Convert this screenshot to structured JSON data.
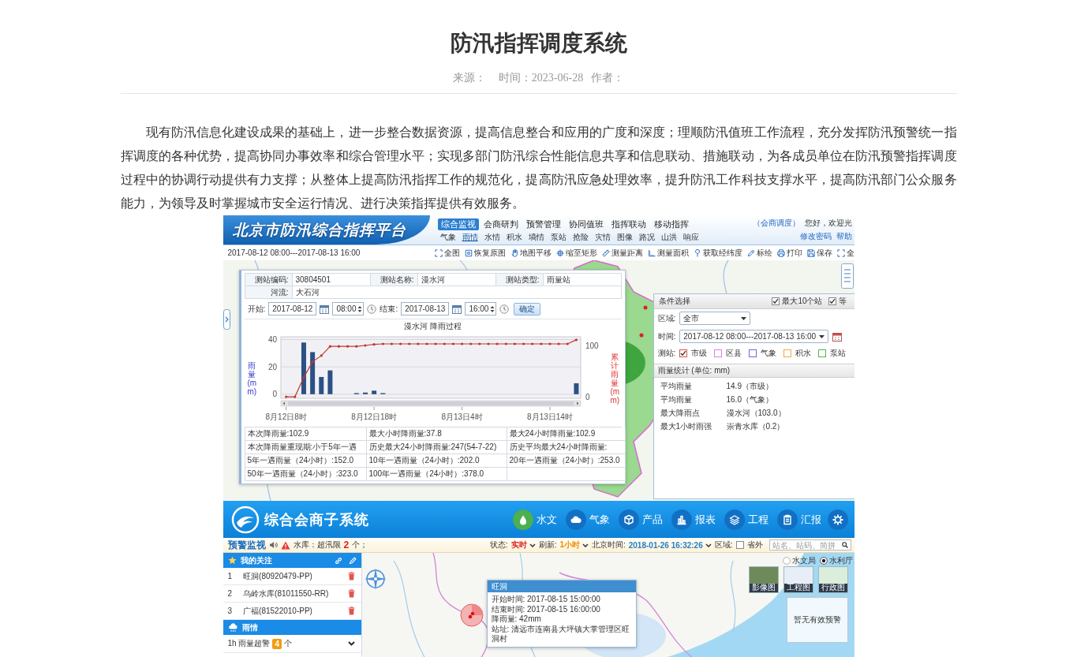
{
  "article": {
    "title": "防汛指挥调度系统",
    "meta": {
      "source_label": "来源：",
      "time_label": "时间：",
      "date": "2023-06-28",
      "author_label": "作者："
    },
    "paragraph": "现有防汛信息化建设成果的基础上，进一步整合数据资源，提高信息整合和应用的广度和深度；理顺防汛值班工作流程，充分发挥防汛预警统一指挥调度的各种优势，提高协同办事效率和综合管理水平；实现多部门防汛综合性能信息共享和信息联动、措施联动，为各成员单位在防汛预警指挥调度过程中的协调行动提供有力支撑；从整体上提高防汛指挥工作的规范化，提高防汛应急处理效率，提升防汛工作科技支撑水平，提高防汛部门公众服务能力，为领导及时掌握城市安全运行情况、进行决策指挥提供有效服务。"
  },
  "platform": {
    "title": "北京市防汛综合指挥平台",
    "main_nav": [
      {
        "label": "综合监视",
        "selected": true
      },
      {
        "label": "会商研判",
        "selected": false
      },
      {
        "label": "预警管理",
        "selected": false
      },
      {
        "label": "协同值班",
        "selected": false
      },
      {
        "label": "指挥联动",
        "selected": false
      },
      {
        "label": "移动指挥",
        "selected": false
      }
    ],
    "sub_nav": [
      {
        "label": "气象",
        "selected": false
      },
      {
        "label": "雨情",
        "selected": true
      },
      {
        "label": "水情",
        "selected": false
      },
      {
        "label": "积水",
        "selected": false
      },
      {
        "label": "墒情",
        "selected": false
      },
      {
        "label": "泵站",
        "selected": false
      },
      {
        "label": "抢险",
        "selected": false
      },
      {
        "label": "灾情",
        "selected": false
      },
      {
        "label": "图像",
        "selected": false
      },
      {
        "label": "路况",
        "selected": false
      },
      {
        "label": "山洪",
        "selected": false
      },
      {
        "label": "响应",
        "selected": false
      }
    ],
    "user": {
      "role": "（会商调度）",
      "greeting": "您好，欢迎光",
      "links": [
        "修改密码",
        "帮助"
      ]
    },
    "time_range": "2017-08-12 08:00---2017-08-13 16:00",
    "tools": [
      "全图",
      "恢复原图",
      "地图平移",
      "缩至矩形",
      "测量距离",
      "测量面积",
      "获取经纬度",
      "标绘",
      "打印",
      "保存",
      "全"
    ],
    "station_panel": {
      "info": [
        {
          "label": "测站编码:",
          "value": "30804501"
        },
        {
          "label": "测站名称:",
          "value": "漫水河"
        },
        {
          "label": "测站类型:",
          "value": "雨量站"
        },
        {
          "label": "河流:",
          "value": "大石河"
        }
      ],
      "start": {
        "label": "开始:",
        "date": "2017-08-12",
        "time": "08:00"
      },
      "end": {
        "label": "结束:",
        "date": "2017-08-13",
        "time": "16:00"
      },
      "confirm": "确定",
      "chart_data": {
        "type": "bar",
        "title": "漫水河 降雨过程",
        "ylabel": "雨量(mm)",
        "y2label": "累计雨量(mm)",
        "categories": [
          "8月12日8时",
          null,
          null,
          null,
          null,
          null,
          null,
          null,
          null,
          null,
          "8月12日18时",
          null,
          null,
          null,
          null,
          null,
          null,
          null,
          null,
          null,
          "8月13日4时",
          null,
          null,
          null,
          null,
          null,
          null,
          null,
          null,
          null,
          "8月13日14时",
          null,
          null,
          null
        ],
        "ylim": [
          -3,
          42
        ],
        "yticks": [
          0,
          20,
          40
        ],
        "y2lim": [
          -3,
          118
        ],
        "y2ticks": [
          0,
          100
        ],
        "grid": true,
        "series": [
          {
            "color": "#2b5185",
            "values": [
              0,
              0,
              37.8,
              30.8,
              12.6,
              17.4,
              0,
              0,
              0.8,
              1.2,
              2.6,
              0.8,
              0,
              0,
              0,
              0,
              0,
              0,
              0,
              0,
              0,
              0,
              0,
              0,
              0,
              0,
              0,
              0,
              0,
              0,
              0,
              0,
              0,
              8
            ]
          },
          {
            "type": "line",
            "axis": "y2",
            "color": "#c0392b",
            "values": [
              0,
              0,
              38,
              69,
              81,
              99,
              99,
              99,
              99,
              101,
              103,
              104,
              104,
              104,
              104,
              104,
              104,
              104,
              104,
              104,
              104,
              104,
              104,
              104,
              104,
              104,
              104,
              104,
              104,
              104,
              104,
              104,
              104,
              112
            ]
          }
        ]
      },
      "stats": [
        [
          "本次降雨量:102.9",
          "最大小时降雨量:37.8",
          "最大24小时降雨量:102.9"
        ],
        [
          "本次降雨量重现期:小于5年一遇",
          "历史最大24小时降雨量:247(54-7-22)",
          "历史平均最大24小时降雨量:"
        ],
        [
          "5年一遇雨量（24小时）:152.0",
          "10年一遇雨量（24小时）:202.0",
          "20年一遇雨量（24小时）:253.0"
        ],
        [
          "50年一遇雨量（24小时）:323.0",
          "100年一遇雨量（24小时）:378.0"
        ]
      ]
    },
    "filter_panel": {
      "title": "条件选择",
      "options": [
        {
          "label": "最大10个站",
          "checked": true
        },
        {
          "label": "等",
          "checked": true
        }
      ],
      "region": {
        "label": "区域:",
        "value": "全市"
      },
      "time": {
        "label": "时间:",
        "value": "2017-08-12 08:00---2017-08-13 16:00"
      },
      "stations": {
        "label": "测站:",
        "types": [
          {
            "label": "市级",
            "checked": true,
            "color": "#e0504a"
          },
          {
            "label": "区县",
            "checked": false,
            "color": "#e07ce0"
          },
          {
            "label": "气象",
            "checked": false,
            "color": "#6a6ae0"
          },
          {
            "label": "积水",
            "checked": false,
            "color": "#f0a848"
          },
          {
            "label": "泵站",
            "checked": false,
            "color": "#52b452"
          }
        ]
      },
      "stats_title": "雨量统计 (单位: mm)",
      "stats": [
        {
          "label": "平均雨量",
          "value": "14.9（市级）"
        },
        {
          "label": "平均雨量",
          "value": "16.0（气象）"
        },
        {
          "label": "最大降雨点",
          "value": "漫水河（103.0）"
        },
        {
          "label": "最大1小时雨强",
          "value": "崇青水库（0.2）"
        }
      ]
    }
  },
  "subsystem": {
    "title": "综合会商子系统",
    "nav": [
      {
        "label": "水文",
        "selected": true
      },
      {
        "label": "气象",
        "selected": false
      },
      {
        "label": "产品",
        "selected": false
      },
      {
        "label": "报表",
        "selected": false
      },
      {
        "label": "工程",
        "selected": false
      },
      {
        "label": "汇报",
        "selected": false
      }
    ],
    "alert_bar": {
      "title": "预警监视",
      "text": "水库：超汛限",
      "count": "2",
      "unit": "个；",
      "status": {
        "label": "状态:",
        "value": "实时"
      },
      "refresh": {
        "label": "刷新:",
        "value": "1小时"
      },
      "clock": {
        "label": "北京时间:",
        "value": "2018-01-26 16:32:26"
      },
      "area": {
        "label": "区域:",
        "option": "省外",
        "checked": false
      },
      "search": {
        "placeholder": "站名、站码、简拼"
      }
    },
    "favorites": {
      "title": "我的关注",
      "items": [
        {
          "index": "1",
          "name": "旺洞(80920479-PP)"
        },
        {
          "index": "2",
          "name": "乌岭水库(81011550-RR)"
        },
        {
          "index": "3",
          "name": "广福(81522010-PP)"
        }
      ]
    },
    "rain": {
      "title": "雨情",
      "rows": [
        {
          "text": "1h 雨量超警",
          "count": "4",
          "unit": "个"
        }
      ]
    },
    "map": {
      "sources": [
        {
          "label": "水文局",
          "selected": false
        },
        {
          "label": "水利厅",
          "selected": true
        }
      ],
      "layers": [
        "影像图",
        "工程图",
        "行政图"
      ],
      "warning_box": "暂无有效预警",
      "popup": {
        "title": "旺洞",
        "lines": [
          "开始时间: 2017-08-15 15:00:00",
          "结束时间: 2017-08-15 16:00:00",
          "降雨量: 42mm",
          "站址: 清远市连南县大坪镇大掌管理区旺洞村"
        ]
      }
    }
  }
}
